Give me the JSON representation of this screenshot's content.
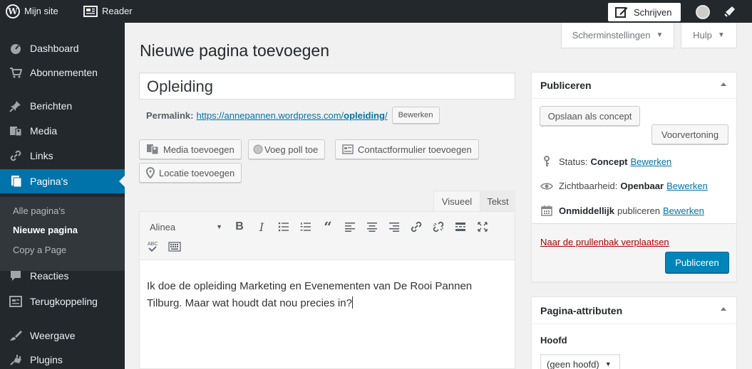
{
  "adminbar": {
    "site_label": "Mijn site",
    "reader_label": "Reader",
    "write_label": "Schrijven"
  },
  "sidebar": {
    "items": [
      {
        "label": "Dashboard",
        "icon": "dashboard-icon"
      },
      {
        "label": "Abonnementen",
        "icon": "cart-icon"
      },
      {
        "label": "Berichten",
        "icon": "pin-icon"
      },
      {
        "label": "Media",
        "icon": "media-icon"
      },
      {
        "label": "Links",
        "icon": "link-icon"
      },
      {
        "label": "Pagina's",
        "icon": "pages-icon"
      },
      {
        "label": "Reacties",
        "icon": "comment-icon"
      },
      {
        "label": "Terugkoppeling",
        "icon": "feedback-icon"
      },
      {
        "label": "Weergave",
        "icon": "brush-icon"
      },
      {
        "label": "Plugins",
        "icon": "plugin-icon"
      }
    ],
    "submenu": [
      "Alle pagina's",
      "Nieuwe pagina",
      "Copy a Page"
    ]
  },
  "screen_options": {
    "options_label": "Scherminstellingen",
    "help_label": "Hulp"
  },
  "page": {
    "title": "Nieuwe pagina toevoegen",
    "post_title": "Opleiding",
    "permalink_label": "Permalink:",
    "permalink_base": "https://annepannen.wordpress.com/",
    "permalink_slug": "opleiding",
    "permalink_trailing": "/",
    "permalink_edit": "Bewerken"
  },
  "media_buttons": {
    "add_media": "Media toevoegen",
    "add_poll": "Voeg poll toe",
    "contact_form": "Contactformulier toevoegen",
    "location": "Locatie toevoegen"
  },
  "editor": {
    "tab_visual": "Visueel",
    "tab_text": "Tekst",
    "format": "Alinea",
    "content_line1": "Ik doe de opleiding Marketing en Evenementen van De Rooi Pannen",
    "content_line2": "Tilburg. Maar wat houdt dat nou precies in?"
  },
  "publish": {
    "heading": "Publiceren",
    "save_draft": "Opslaan als concept",
    "preview": "Voorvertoning",
    "status_label": "Status:",
    "status_value": "Concept",
    "visibility_label": "Zichtbaarheid:",
    "visibility_value": "Openbaar",
    "schedule_value": "Onmiddellijk",
    "schedule_suffix": "publiceren",
    "edit": "Bewerken",
    "trash": "Naar de prullenbak verplaatsen",
    "publish_button": "Publiceren"
  },
  "page_attributes": {
    "heading": "Pagina-attributen",
    "parent_label": "Hoofd",
    "parent_value": "(geen hoofd)"
  },
  "colors": {
    "accent": "#0073aa",
    "sidebar": "#23282d",
    "publish": "#0085ba",
    "trash": "#aa0000"
  }
}
